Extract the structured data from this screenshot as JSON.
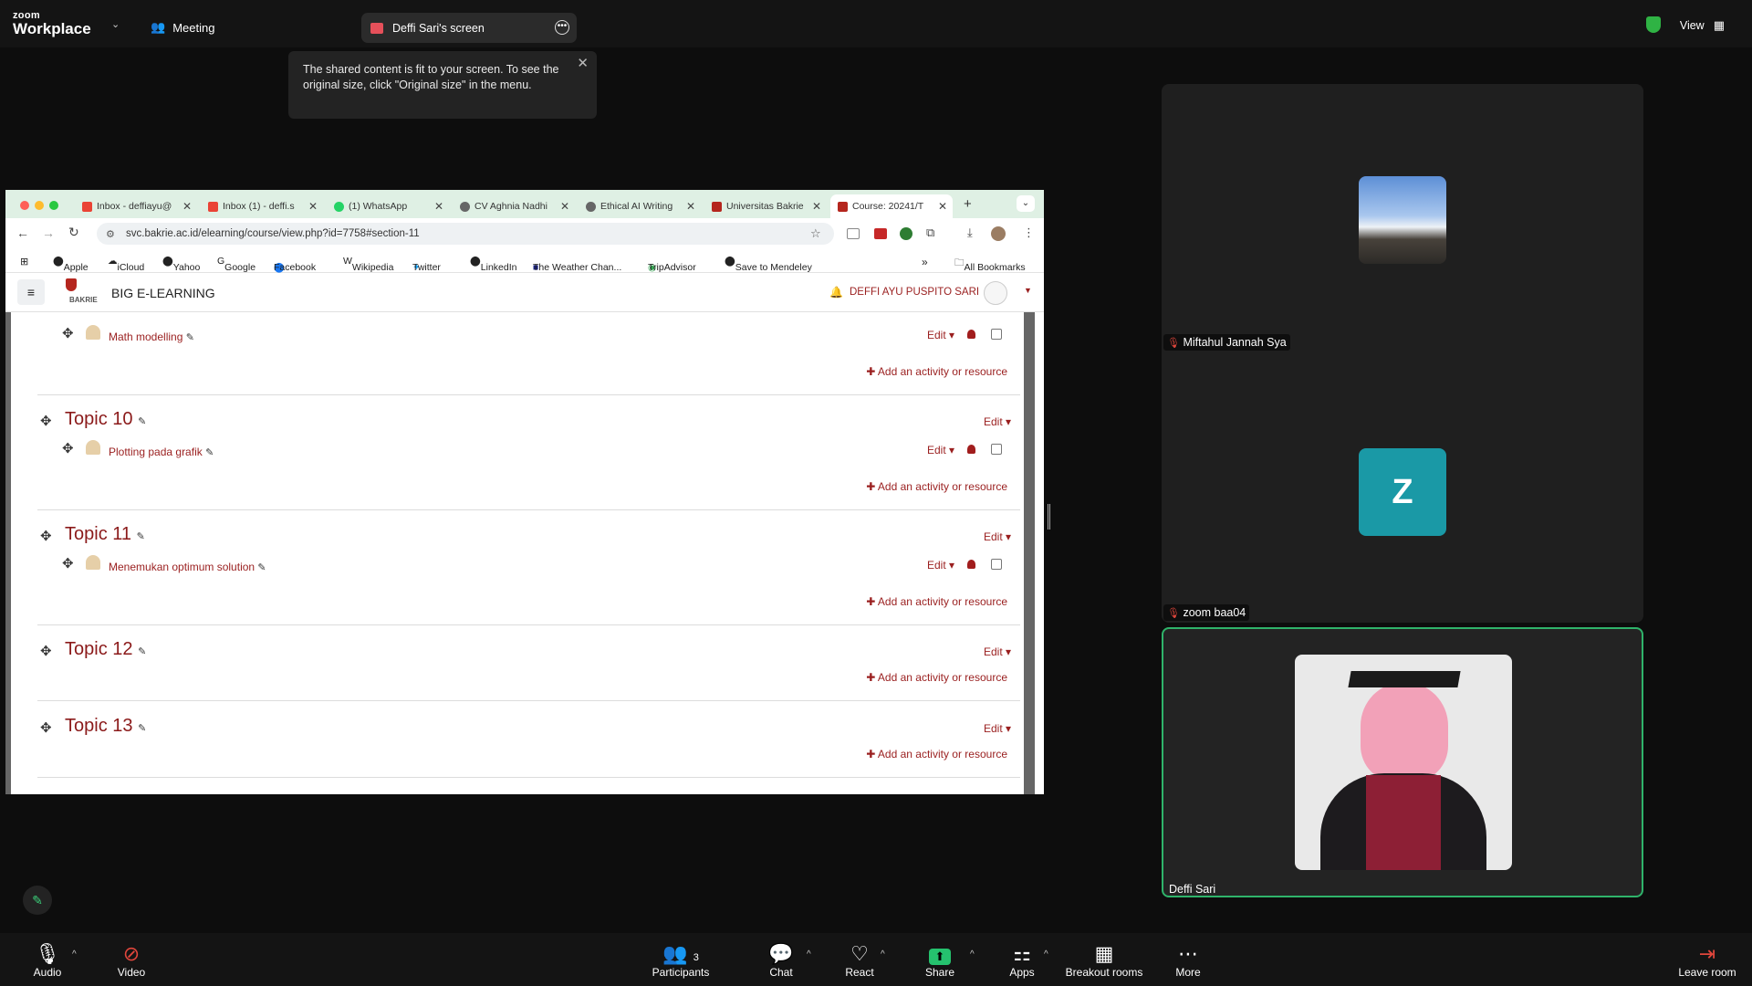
{
  "zoom": {
    "logo_small": "zoom",
    "logo_big": "Workplace",
    "meeting_label": "Meeting",
    "share_pill": "Deffi Sari's screen",
    "tooltip": "The shared content is fit to your screen. To see the original size, click \"Original size\" in the menu.",
    "view_label": "View"
  },
  "browser": {
    "tabs": [
      {
        "label": "Inbox - deffiayu@"
      },
      {
        "label": "Inbox (1) - deffi.s"
      },
      {
        "label": "(1) WhatsApp"
      },
      {
        "label": "CV Aghnia Nadhi"
      },
      {
        "label": "Ethical AI Writing"
      },
      {
        "label": "Universitas Bakrie"
      },
      {
        "label": "Course: 20241/T"
      }
    ],
    "url": "svc.bakrie.ac.id/elearning/course/view.php?id=7758#section-11",
    "bookmarks": [
      "Apple",
      "iCloud",
      "Yahoo",
      "Google",
      "Facebook",
      "Wikipedia",
      "Twitter",
      "LinkedIn",
      "The Weather Chan...",
      "TripAdvisor",
      "Save to Mendeley"
    ],
    "all_bookmarks": "All Bookmarks"
  },
  "lms": {
    "brand_top": "BAKRIE",
    "title": "BIG E-LEARNING",
    "user": "DEFFI AYU PUSPITO SARI",
    "edit_label": "Edit",
    "add_label": "Add an activity or resource",
    "first_activity": "Math modelling",
    "topics": [
      {
        "title": "Topic 10",
        "activity": "Plotting pada grafik"
      },
      {
        "title": "Topic 11",
        "activity": "Menemukan optimum solution"
      },
      {
        "title": "Topic 12"
      },
      {
        "title": "Topic 13"
      }
    ]
  },
  "participants": [
    {
      "name": "Miftahul Jannah Sya",
      "muted": true
    },
    {
      "name": "zoom baa04",
      "muted": true,
      "initial": "Z"
    },
    {
      "name": "Deffi Sari",
      "muted": false
    }
  ],
  "toolbar": {
    "audio": "Audio",
    "video": "Video",
    "participants": "Participants",
    "participants_count": "3",
    "chat": "Chat",
    "react": "React",
    "share": "Share",
    "apps": "Apps",
    "breakout": "Breakout rooms",
    "more": "More",
    "leave": "Leave room"
  },
  "colors": {
    "zoom_accent": "#2fb36a",
    "lms_red": "#9a1f1f",
    "avatar_teal": "#1a99a6",
    "share_green": "#25c26e"
  }
}
